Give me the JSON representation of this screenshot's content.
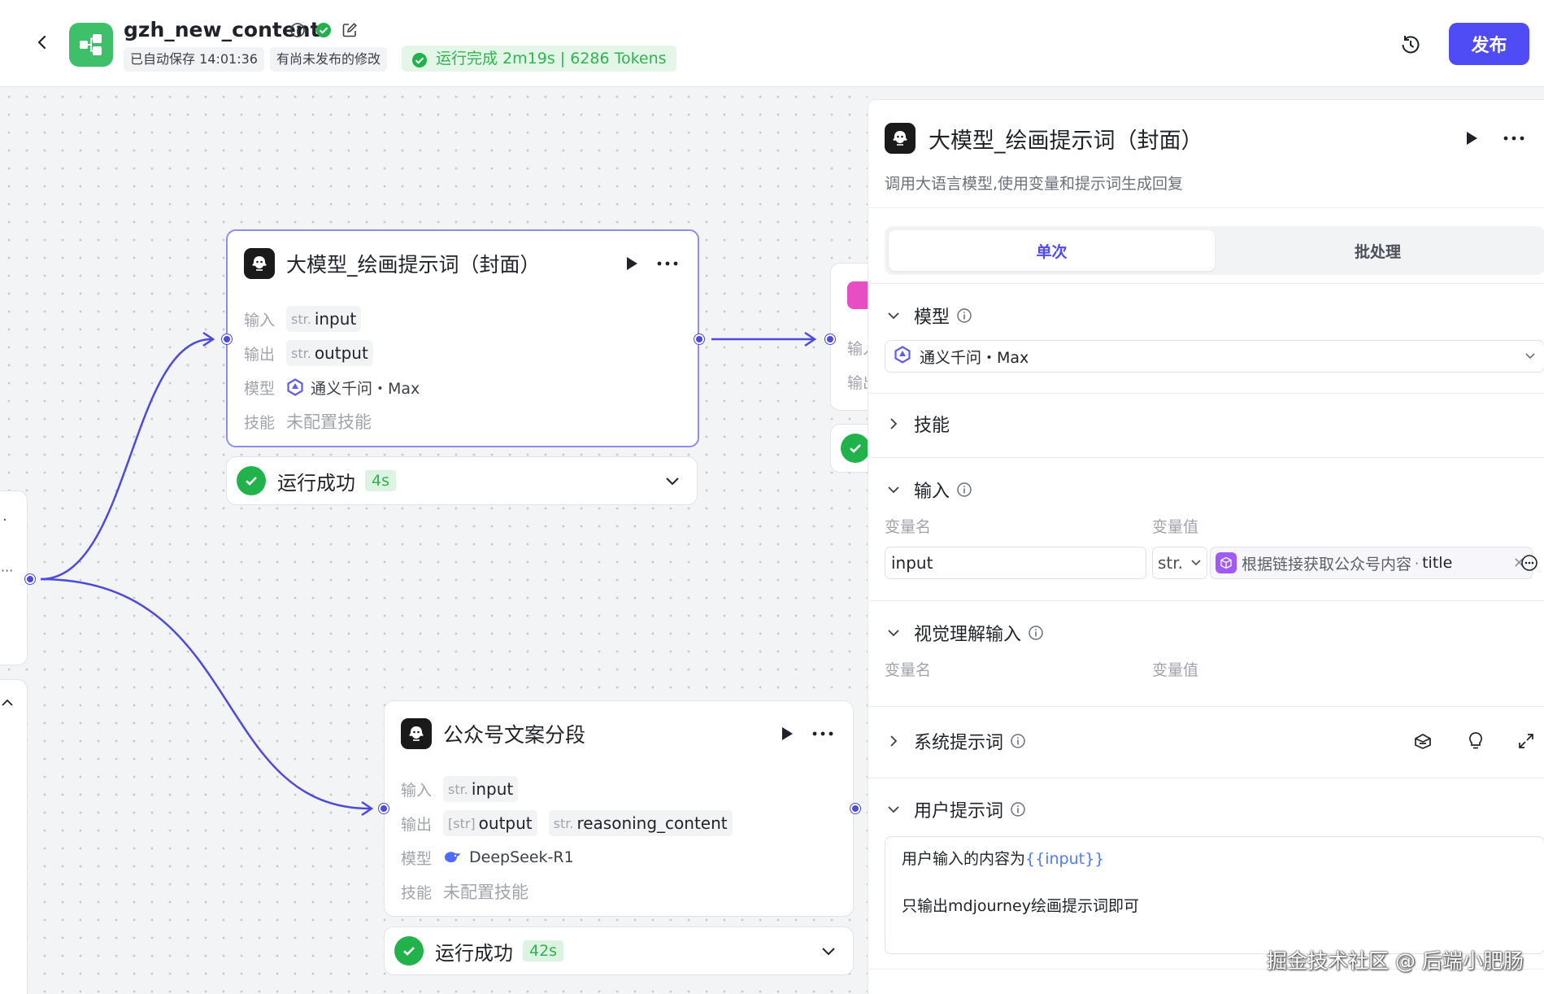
{
  "header": {
    "app_name": "gzh_new_content",
    "autosave": "已自动保存 14:01:36",
    "unpublished": "有尚未发布的修改",
    "run_status": "运行完成 2m19s | 6286 Tokens",
    "publish_label": "发布"
  },
  "canvas": {
    "node_draw_cover": {
      "title": "大模型_绘画提示词（封面）",
      "input_label": "输入",
      "input_type": "str.",
      "input_name": "input",
      "output_label": "输出",
      "output_type": "str.",
      "output_name": "output",
      "model_label": "模型",
      "model_name": "通义千问・Max",
      "skill_label": "技能",
      "skill_value": "未配置技能",
      "status": "运行成功",
      "duration": "4s"
    },
    "node_segment": {
      "title": "公众号文案分段",
      "input_label": "输入",
      "input_type": "str.",
      "input_name": "input",
      "output_label": "输出",
      "output_type": "[str]",
      "output_name": "output",
      "output2_type": "str.",
      "output2_name": "reasoning_content",
      "model_label": "模型",
      "model_name": "DeepSeek-R1",
      "skill_label": "技能",
      "skill_value": "未配置技能",
      "status": "运行成功",
      "duration": "42s"
    },
    "partial_node_labels": [
      "输入",
      "输出"
    ]
  },
  "panel": {
    "title": "大模型_绘画提示词（封面）",
    "description": "调用大语言模型,使用变量和提示词生成回复",
    "tabs": [
      "单次",
      "批处理"
    ],
    "active_tab": 0,
    "model_section": "模型",
    "model_name": "通义千问・Max",
    "skills_section": "技能",
    "input_section": "输入",
    "col_var_name": "变量名",
    "col_var_value": "变量值",
    "input_var_name": "input",
    "input_var_type": "str.",
    "ref_source": "根据链接获取公众号内容",
    "ref_field": "title",
    "vision_section": "视觉理解输入",
    "system_prompt_section": "系统提示词",
    "user_prompt_section": "用户提示词",
    "user_prompt_prefix": "用户输入的内容为",
    "user_prompt_var": "{{input}}",
    "user_prompt_line2": "只输出mdjourney绘画提示词即可"
  },
  "watermark": "掘金技术社区 @ 后端小肥肠",
  "colors": {
    "accent": "#4f4cf6",
    "success": "#22b24c",
    "edge": "#4d4ae0",
    "app_logo": "#3ec06a"
  },
  "icons": [
    "back-icon",
    "workflow-logo-icon",
    "info-icon",
    "check-circle-icon",
    "edit-icon",
    "history-icon",
    "llm-node-icon",
    "play-icon",
    "more-icon",
    "qwen-icon",
    "deepseek-icon",
    "chevron-down-icon",
    "chevron-right-icon",
    "cube-icon",
    "prompt-library-icon",
    "bulb-icon",
    "expand-icon"
  ]
}
